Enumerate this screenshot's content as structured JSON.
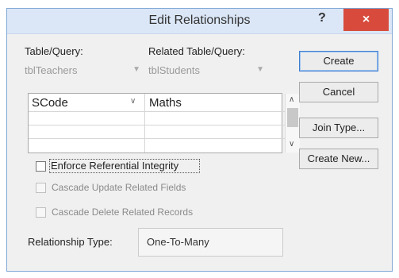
{
  "dialog": {
    "title": "Edit Relationships",
    "help_glyph": "?",
    "close_glyph": "×"
  },
  "headers": {
    "table_query": "Table/Query:",
    "related_table_query": "Related Table/Query:"
  },
  "combos": {
    "table": "tblTeachers",
    "related_table": "tblStudents"
  },
  "fields_grid": {
    "rows": [
      {
        "left": "SCode",
        "right": "Maths"
      }
    ]
  },
  "buttons": {
    "create": "Create",
    "cancel": "Cancel",
    "join_type": "Join Type...",
    "create_new": "Create New..."
  },
  "options": {
    "enforce_referential_integrity": {
      "label": "Enforce Referential Integrity",
      "checked": false
    },
    "cascade_update": {
      "label": "Cascade Update Related Fields",
      "checked": false,
      "disabled": true
    },
    "cascade_delete": {
      "label": "Cascade Delete Related Records",
      "checked": false,
      "disabled": true
    }
  },
  "relationship_type": {
    "label": "Relationship Type:",
    "value": "One-To-Many"
  }
}
